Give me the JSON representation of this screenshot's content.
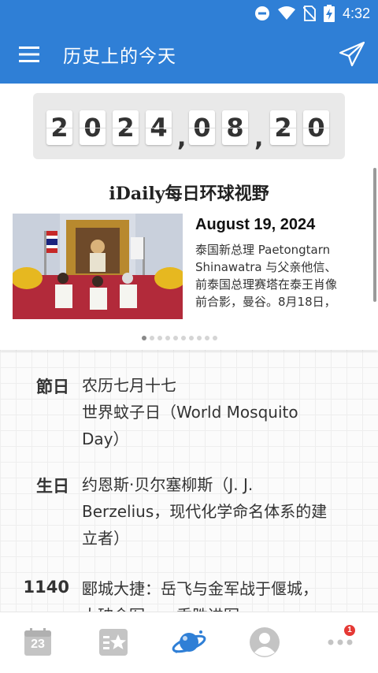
{
  "status_bar": {
    "time": "4:32"
  },
  "app_bar": {
    "title": "历史上的今天"
  },
  "date_counter": {
    "year_digits": [
      "2",
      "0",
      "2",
      "4"
    ],
    "month_digits": [
      "0",
      "8"
    ],
    "day_digits": [
      "2",
      "0"
    ],
    "separator": ","
  },
  "daily_card": {
    "title": "iDaily每日环球视野",
    "date": "August 19, 2024",
    "text_lines": [
      "泰国新总理 Paetongtarn",
      "Shinawatra 与父亲他信、",
      "前泰国总理赛塔在泰王肖像",
      "前合影，曼谷。8月18日，"
    ],
    "page_count": 10,
    "active_page": 0
  },
  "events": [
    {
      "label": "節日",
      "lines": [
        "农历七月十七",
        "世界蚊子日（World Mosquito",
        "Day）"
      ]
    },
    {
      "label": "生日",
      "lines": [
        "约恩斯·贝尔塞柳斯（J. J.",
        "Berzelius，现代化学命名体系的建",
        "立者）"
      ]
    },
    {
      "label": "1140",
      "lines": [
        "郾城大捷：岳飞与金军战于偃城，",
        "大破金军……乘胜进军"
      ]
    }
  ],
  "tab_bar": {
    "calendar_day": "23",
    "badge_count": "1",
    "icons": [
      "calendar-icon",
      "favorites-icon",
      "planet-icon",
      "profile-icon",
      "more-icon"
    ],
    "active_color": "#2f7fd6",
    "inactive_color": "#c4c4c4"
  },
  "colors": {
    "brand_blue": "#2f7fd6",
    "badge_red": "#e53935"
  }
}
